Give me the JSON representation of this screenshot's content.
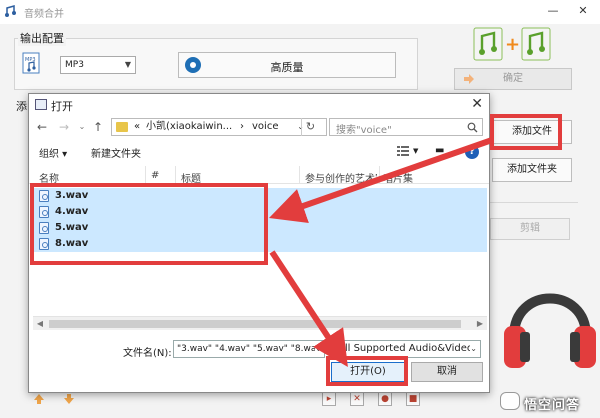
{
  "app": {
    "title": "音频合并",
    "minimize": "—",
    "close": "✕",
    "output_group_title": "输出配置",
    "format_value": "MP3",
    "quality_label": "高质量",
    "confirm_label": "确定",
    "add_file_label": "添加文件",
    "add_folder_label": "添加文件夹",
    "cut_label": "剪辑",
    "side_fragment": "添",
    "watermark_text": "悟空问答"
  },
  "dialog": {
    "title": "打开",
    "close": "✕",
    "address": {
      "prefix": "«",
      "crumb1": "小凯(xiaokaiwin...",
      "separator": "›",
      "crumb2": "voice"
    },
    "search_placeholder": "搜索\"voice\"",
    "toolbar": {
      "organize": "组织 ▾",
      "new_folder": "新建文件夹",
      "help": "?"
    },
    "columns": [
      "名称",
      "#",
      "标题",
      "参与创作的艺术家",
      "唱片集"
    ],
    "files": [
      "3.wav",
      "4.wav",
      "5.wav",
      "8.wav"
    ],
    "filename_label": "文件名(N):",
    "filename_value": "\"3.wav\" \"4.wav\" \"5.wav\" \"8.wav\"",
    "filetype_value": "All Supported Audio&Video",
    "open_label": "打开(O)",
    "cancel_label": "取消"
  },
  "colors": {
    "annotation_red": "#e23d3d",
    "selection_blue": "#cce8ff",
    "accent_blue": "#1a6ecb"
  },
  "icons": [
    "app-logo-icon",
    "mp3-icon",
    "quality-icon",
    "merge-logo-icon",
    "back-icon",
    "forward-icon",
    "up-icon",
    "folder-icon",
    "refresh-icon",
    "search-icon",
    "view-icon",
    "help-icon",
    "wav-file-icon",
    "headphones-icon"
  ]
}
